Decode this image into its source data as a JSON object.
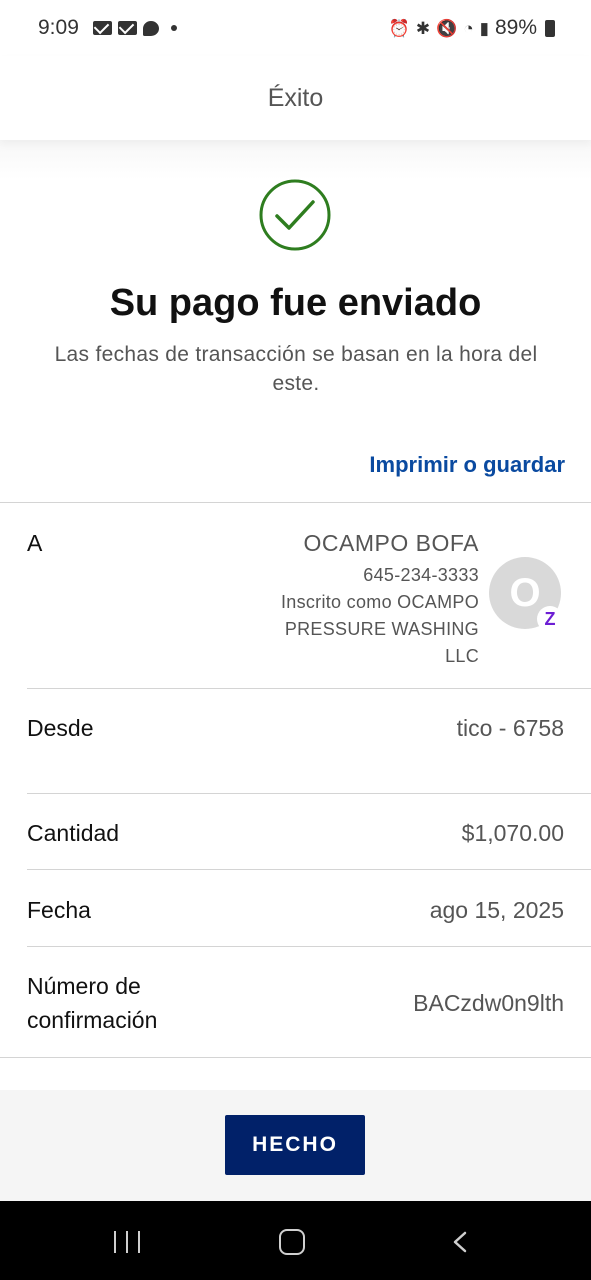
{
  "status_bar": {
    "time": "9:09",
    "battery": "89%"
  },
  "header": {
    "title": "Éxito"
  },
  "confirmation": {
    "headline": "Su pago fue enviado",
    "subtext": "Las fechas de transacción se basan en la hora del este.",
    "print_link": "Imprimir o guardar"
  },
  "details": {
    "to_label": "A",
    "recipient_name": "OCAMPO BOFA",
    "recipient_phone": "645-234-3333",
    "recipient_enrolled_line1": "Inscrito como OCAMPO",
    "recipient_enrolled_line2": "PRESSURE WASHING",
    "recipient_enrolled_line3": "LLC",
    "avatar_initial": "O",
    "zelle_mark": "Z",
    "from_label": "Desde",
    "from_value": "tico - 6758",
    "amount_label": "Cantidad",
    "amount_value": "$1,070.00",
    "date_label": "Fecha",
    "date_value": "ago 15, 2025",
    "confirmation_label_line1": "Número de",
    "confirmation_label_line2": "confirmación",
    "confirmation_value": "BACzdw0n9lth"
  },
  "footer": {
    "done_label": "HECHO"
  },
  "colors": {
    "success_green": "#2e7d1f",
    "link_blue": "#0a4aa0",
    "button_navy": "#012169",
    "zelle_purple": "#6d1ed4"
  }
}
